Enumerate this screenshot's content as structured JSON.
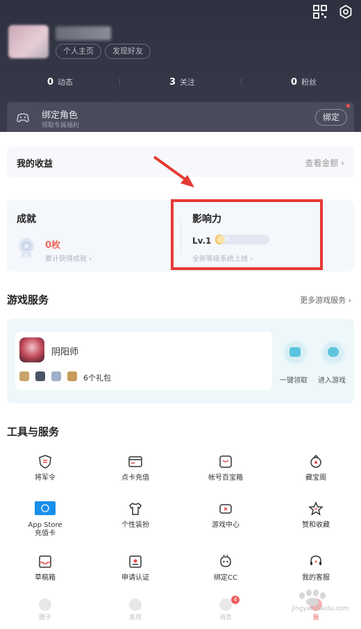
{
  "header": {
    "profile_chip": "个人主页",
    "find_friends_chip": "发现好友",
    "stats": [
      {
        "value": "0",
        "label": "动态"
      },
      {
        "value": "3",
        "label": "关注"
      },
      {
        "value": "0",
        "label": "粉丝"
      }
    ],
    "bind_card": {
      "title": "绑定角色",
      "subtitle": "领取专属福利",
      "button": "绑定"
    }
  },
  "income": {
    "title": "我的收益",
    "link": "查看金额"
  },
  "achievement": {
    "title": "成就",
    "count": "0枚",
    "sub": "累计获得成就"
  },
  "influence": {
    "title": "影响力",
    "level": "Lv.1",
    "level_value": "0",
    "progress_fraction": 0.15,
    "sub": "全新等级系统上线"
  },
  "game_services": {
    "title": "游戏服务",
    "more": "更多游戏服务",
    "game_name": "阴阳师",
    "gift_count": "6个礼包",
    "claim_label": "一键领取",
    "enter_label": "进入游戏"
  },
  "tools": {
    "title": "工具与服务",
    "items": [
      {
        "label": "将军令",
        "icon": "shield-token-icon"
      },
      {
        "label": "点卡充值",
        "icon": "card-icon"
      },
      {
        "label": "帐号百宝箱",
        "icon": "treasure-box-icon"
      },
      {
        "label": "藏宝阁",
        "icon": "treasure-pavilion-icon"
      },
      {
        "label": "App Store\n充值卡",
        "icon": "app-store-icon"
      },
      {
        "label": "个性装扮",
        "icon": "tshirt-icon"
      },
      {
        "label": "游戏中心",
        "icon": "gamepad-icon"
      },
      {
        "label": "赞和收藏",
        "icon": "star-icon"
      },
      {
        "label": "草稿箱",
        "icon": "inbox-icon"
      },
      {
        "label": "申请认证",
        "icon": "certificate-icon"
      },
      {
        "label": "绑定CC",
        "icon": "cc-icon"
      },
      {
        "label": "我的客服",
        "icon": "headset-icon"
      }
    ]
  },
  "bottom_nav": {
    "items": [
      {
        "label": "圈子"
      },
      {
        "label": "发现"
      },
      {
        "label": "消息",
        "badge": "4"
      },
      {
        "label": "我"
      }
    ]
  },
  "watermark": {
    "text": "jingyan.baidu.com"
  },
  "colors": {
    "header_bg": "#2f3140",
    "accent_red": "#e53935",
    "achievement_count": "#ef6b5f",
    "game_panel_bg": "#eef7fa"
  }
}
